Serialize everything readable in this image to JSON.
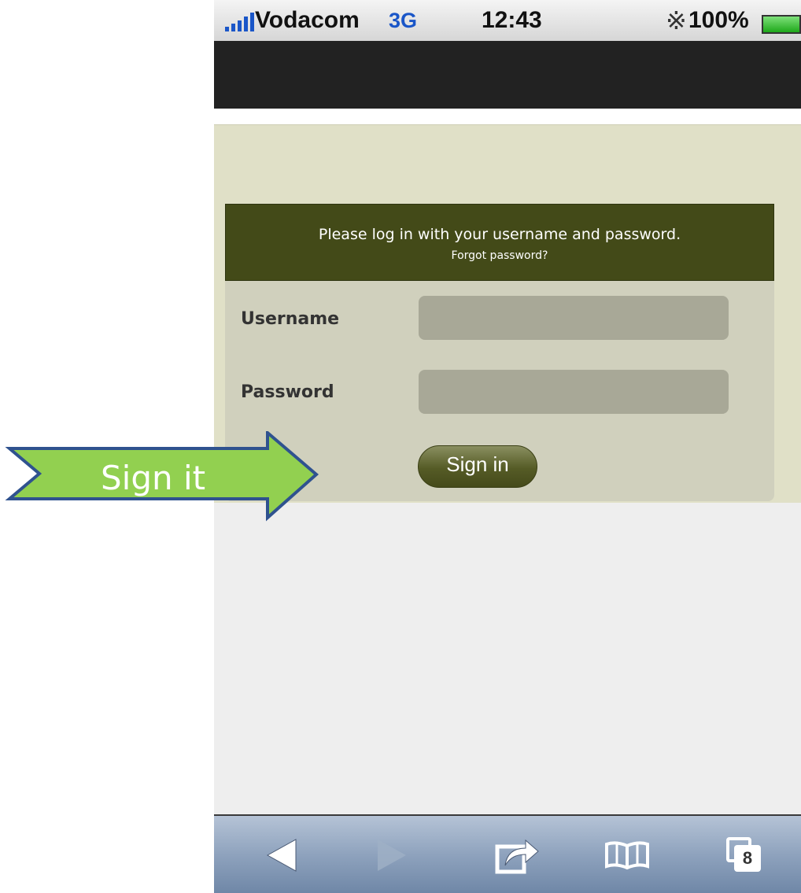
{
  "status_bar": {
    "carrier": "Vodacom",
    "network": "3G",
    "time": "12:43",
    "battery": "100%",
    "signal_icon": "signal-bars-icon",
    "bluetooth_icon": "bluetooth-icon",
    "battery_icon": "battery-icon"
  },
  "login": {
    "message": "Please log in with your username and password.",
    "forgot_link": "Forgot password?",
    "username_label": "Username",
    "username_value": "",
    "password_label": "Password",
    "password_value": "",
    "sign_in_label": "Sign in"
  },
  "annotation": {
    "label": "Sign it",
    "arrow_color": "#92d050",
    "arrow_border": "#2f528f"
  },
  "toolbar": {
    "tabs_count": "8",
    "icons": [
      "back-icon",
      "forward-icon",
      "share-icon",
      "bookmarks-icon",
      "tabs-icon"
    ]
  },
  "colors": {
    "login_header": "#434a18",
    "page_background": "#e0e0c7",
    "button": "#555b26"
  }
}
